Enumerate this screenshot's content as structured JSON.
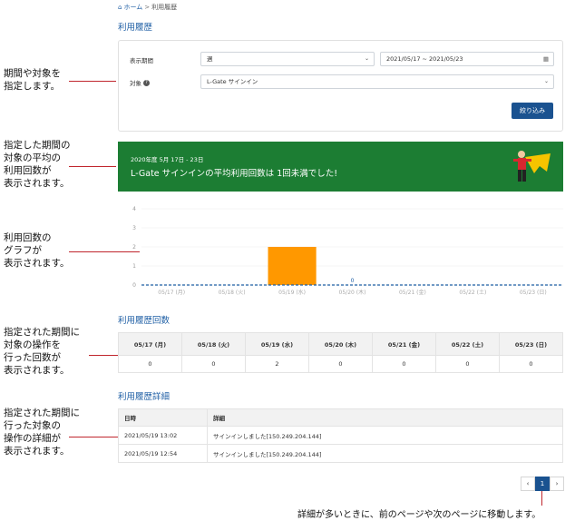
{
  "breadcrumb": {
    "home": "ホーム",
    "sep": ">",
    "current": "利用履歴"
  },
  "page_title": "利用履歴",
  "filter": {
    "period_label": "表示期間",
    "period_value": "週",
    "date_range": "2021/05/17 ~ 2021/05/23",
    "target_label": "対象",
    "target_value": "L-Gate サインイン",
    "submit_label": "絞り込み"
  },
  "banner": {
    "date": "2020年度 5月 17日 - 23日",
    "message": "L-Gate サインインの平均利用回数は 1回未満でした!"
  },
  "chart_data": {
    "type": "bar",
    "categories": [
      "05/17 (月)",
      "05/18 (火)",
      "05/19 (水)",
      "05/20 (木)",
      "05/21 (金)",
      "05/22 (土)",
      "05/23 (日)"
    ],
    "values": [
      0,
      0,
      2,
      0,
      0,
      0,
      0
    ],
    "average": 0,
    "average_label": "0",
    "ylim": [
      0,
      4
    ],
    "yticks": [
      "0",
      "1",
      "2",
      "3",
      "4"
    ],
    "bar_color": "#ff9800",
    "average_color": "#1f5fa5",
    "grid": true
  },
  "count_section": {
    "title": "利用履歴回数",
    "headers": [
      "05/17 (月)",
      "05/18 (火)",
      "05/19 (水)",
      "05/20 (木)",
      "05/21 (金)",
      "05/22 (土)",
      "05/23 (日)"
    ],
    "values": [
      "0",
      "0",
      "2",
      "0",
      "0",
      "0",
      "0"
    ]
  },
  "detail_section": {
    "title": "利用履歴詳細",
    "headers": [
      "日時",
      "詳細"
    ],
    "rows": [
      [
        "2021/05/19 13:02",
        "サインインしました[150.249.204.144]"
      ],
      [
        "2021/05/19 12:54",
        "サインインしました[150.249.204.144]"
      ]
    ]
  },
  "pager": {
    "prev": "‹",
    "current": "1",
    "next": "›"
  },
  "annotations": {
    "a1": "期間や対象を\n指定します。",
    "a2": "指定した期間の\n対象の平均の\n利用回数が\n表示されます。",
    "a3": "利用回数の\nグラフが\n表示されます。",
    "a4": "指定された期間に\n対象の操作を\n行った回数が\n表示されます。",
    "a5": "指定された期間に\n行った対象の\n操作の詳細が\n表示されます。",
    "pager_note": "詳細が多いときに、前のページや次のページに移動します。"
  },
  "colors": {
    "accent": "#1f5fa5",
    "primary_button": "#1a5290",
    "banner": "#1c7d33",
    "annotation_line": "#c0262d"
  }
}
